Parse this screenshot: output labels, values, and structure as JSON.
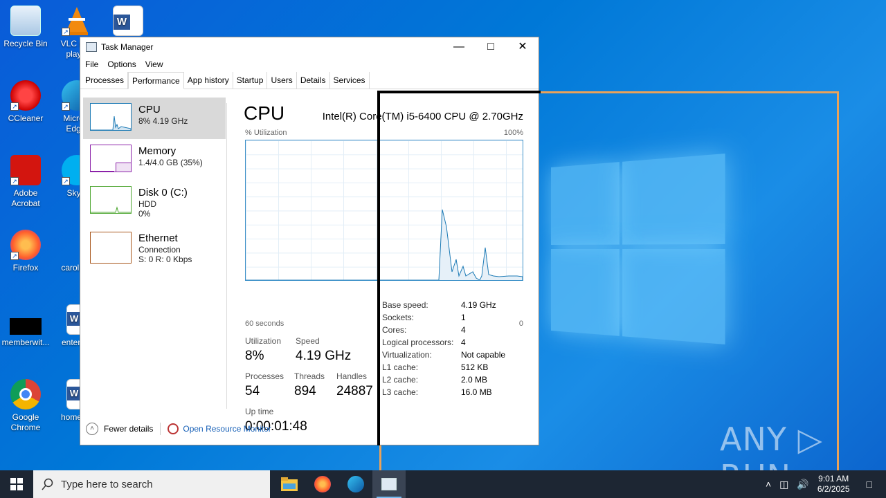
{
  "desktop": {
    "icons": [
      {
        "label": "Recycle Bin"
      },
      {
        "label": "VLC m... play..."
      },
      {
        "label": "CCleaner"
      },
      {
        "label": "Micro... Edg..."
      },
      {
        "label": "Adobe Acrobat"
      },
      {
        "label": "Sky..."
      },
      {
        "label": "Firefox"
      },
      {
        "label": "carolin..."
      },
      {
        "label": "memberwit..."
      },
      {
        "label": "enterp..."
      },
      {
        "label": "Google Chrome"
      },
      {
        "label": "homes..."
      }
    ],
    "watermark": "ANY ▷ RUN"
  },
  "window": {
    "title": "Task Manager",
    "menu": [
      "File",
      "Options",
      "View"
    ],
    "tabs": [
      "Processes",
      "Performance",
      "App history",
      "Startup",
      "Users",
      "Details",
      "Services"
    ],
    "active_tab": "Performance"
  },
  "sidebar": {
    "items": [
      {
        "title": "CPU",
        "line1": "8%  4.19 GHz",
        "line2": "",
        "color": "#1c7ab5"
      },
      {
        "title": "Memory",
        "line1": "1.4/4.0 GB (35%)",
        "line2": "",
        "color": "#8b21a8",
        "level": 0.35
      },
      {
        "title": "Disk 0 (C:)",
        "line1": "HDD",
        "line2": "0%",
        "color": "#4da630"
      },
      {
        "title": "Ethernet",
        "line1": "Connection",
        "line2": "S: 0  R: 0 Kbps",
        "color": "#a7561a"
      }
    ]
  },
  "main": {
    "heading": "CPU",
    "model": "Intel(R) Core(TM) i5-6400 CPU @ 2.70GHz",
    "graph_label": "% Utilization",
    "graph_max": "100%",
    "graph_time": "60 seconds",
    "graph_min": "0",
    "stats": {
      "utilization_label": "Utilization",
      "utilization": "8%",
      "speed_label": "Speed",
      "speed": "4.19 GHz",
      "processes_label": "Processes",
      "processes": "54",
      "threads_label": "Threads",
      "threads": "894",
      "handles_label": "Handles",
      "handles": "24887",
      "uptime_label": "Up time",
      "uptime": "0:00:01:48"
    },
    "specs": [
      {
        "k": "Base speed:",
        "v": "4.19 GHz"
      },
      {
        "k": "Sockets:",
        "v": "1"
      },
      {
        "k": "Cores:",
        "v": "4"
      },
      {
        "k": "Logical processors:",
        "v": "4"
      },
      {
        "k": "Virtualization:",
        "v": "Not capable"
      },
      {
        "k": "L1 cache:",
        "v": "512 KB"
      },
      {
        "k": "L2 cache:",
        "v": "2.0 MB"
      },
      {
        "k": "L3 cache:",
        "v": "16.0 MB"
      }
    ]
  },
  "footer": {
    "fewer": "Fewer details",
    "resmon": "Open Resource Monitor"
  },
  "taskbar": {
    "search_placeholder": "Type here to search",
    "time": "9:01 AM",
    "date": "6/2/2025"
  }
}
